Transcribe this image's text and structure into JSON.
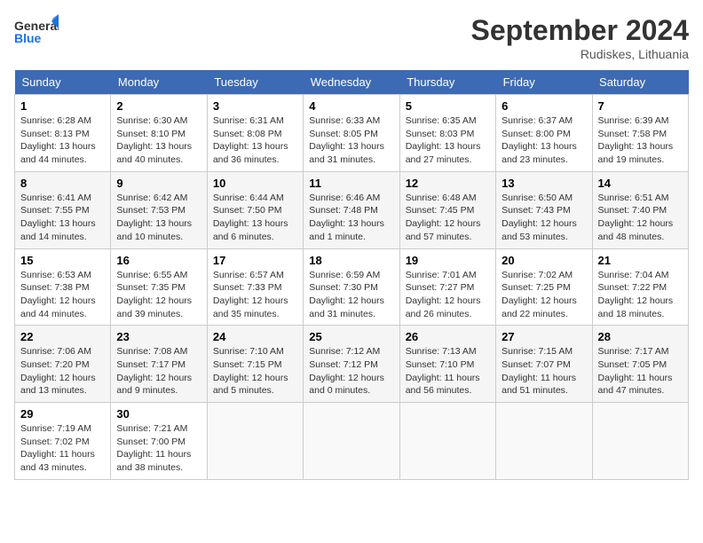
{
  "header": {
    "logo_general": "General",
    "logo_blue": "Blue",
    "month_title": "September 2024",
    "location": "Rudiskes, Lithuania"
  },
  "weekdays": [
    "Sunday",
    "Monday",
    "Tuesday",
    "Wednesday",
    "Thursday",
    "Friday",
    "Saturday"
  ],
  "weeks": [
    [
      {
        "day": "1",
        "info": "Sunrise: 6:28 AM\nSunset: 8:13 PM\nDaylight: 13 hours\nand 44 minutes."
      },
      {
        "day": "2",
        "info": "Sunrise: 6:30 AM\nSunset: 8:10 PM\nDaylight: 13 hours\nand 40 minutes."
      },
      {
        "day": "3",
        "info": "Sunrise: 6:31 AM\nSunset: 8:08 PM\nDaylight: 13 hours\nand 36 minutes."
      },
      {
        "day": "4",
        "info": "Sunrise: 6:33 AM\nSunset: 8:05 PM\nDaylight: 13 hours\nand 31 minutes."
      },
      {
        "day": "5",
        "info": "Sunrise: 6:35 AM\nSunset: 8:03 PM\nDaylight: 13 hours\nand 27 minutes."
      },
      {
        "day": "6",
        "info": "Sunrise: 6:37 AM\nSunset: 8:00 PM\nDaylight: 13 hours\nand 23 minutes."
      },
      {
        "day": "7",
        "info": "Sunrise: 6:39 AM\nSunset: 7:58 PM\nDaylight: 13 hours\nand 19 minutes."
      }
    ],
    [
      {
        "day": "8",
        "info": "Sunrise: 6:41 AM\nSunset: 7:55 PM\nDaylight: 13 hours\nand 14 minutes."
      },
      {
        "day": "9",
        "info": "Sunrise: 6:42 AM\nSunset: 7:53 PM\nDaylight: 13 hours\nand 10 minutes."
      },
      {
        "day": "10",
        "info": "Sunrise: 6:44 AM\nSunset: 7:50 PM\nDaylight: 13 hours\nand 6 minutes."
      },
      {
        "day": "11",
        "info": "Sunrise: 6:46 AM\nSunset: 7:48 PM\nDaylight: 13 hours\nand 1 minute."
      },
      {
        "day": "12",
        "info": "Sunrise: 6:48 AM\nSunset: 7:45 PM\nDaylight: 12 hours\nand 57 minutes."
      },
      {
        "day": "13",
        "info": "Sunrise: 6:50 AM\nSunset: 7:43 PM\nDaylight: 12 hours\nand 53 minutes."
      },
      {
        "day": "14",
        "info": "Sunrise: 6:51 AM\nSunset: 7:40 PM\nDaylight: 12 hours\nand 48 minutes."
      }
    ],
    [
      {
        "day": "15",
        "info": "Sunrise: 6:53 AM\nSunset: 7:38 PM\nDaylight: 12 hours\nand 44 minutes."
      },
      {
        "day": "16",
        "info": "Sunrise: 6:55 AM\nSunset: 7:35 PM\nDaylight: 12 hours\nand 39 minutes."
      },
      {
        "day": "17",
        "info": "Sunrise: 6:57 AM\nSunset: 7:33 PM\nDaylight: 12 hours\nand 35 minutes."
      },
      {
        "day": "18",
        "info": "Sunrise: 6:59 AM\nSunset: 7:30 PM\nDaylight: 12 hours\nand 31 minutes."
      },
      {
        "day": "19",
        "info": "Sunrise: 7:01 AM\nSunset: 7:27 PM\nDaylight: 12 hours\nand 26 minutes."
      },
      {
        "day": "20",
        "info": "Sunrise: 7:02 AM\nSunset: 7:25 PM\nDaylight: 12 hours\nand 22 minutes."
      },
      {
        "day": "21",
        "info": "Sunrise: 7:04 AM\nSunset: 7:22 PM\nDaylight: 12 hours\nand 18 minutes."
      }
    ],
    [
      {
        "day": "22",
        "info": "Sunrise: 7:06 AM\nSunset: 7:20 PM\nDaylight: 12 hours\nand 13 minutes."
      },
      {
        "day": "23",
        "info": "Sunrise: 7:08 AM\nSunset: 7:17 PM\nDaylight: 12 hours\nand 9 minutes."
      },
      {
        "day": "24",
        "info": "Sunrise: 7:10 AM\nSunset: 7:15 PM\nDaylight: 12 hours\nand 5 minutes."
      },
      {
        "day": "25",
        "info": "Sunrise: 7:12 AM\nSunset: 7:12 PM\nDaylight: 12 hours\nand 0 minutes."
      },
      {
        "day": "26",
        "info": "Sunrise: 7:13 AM\nSunset: 7:10 PM\nDaylight: 11 hours\nand 56 minutes."
      },
      {
        "day": "27",
        "info": "Sunrise: 7:15 AM\nSunset: 7:07 PM\nDaylight: 11 hours\nand 51 minutes."
      },
      {
        "day": "28",
        "info": "Sunrise: 7:17 AM\nSunset: 7:05 PM\nDaylight: 11 hours\nand 47 minutes."
      }
    ],
    [
      {
        "day": "29",
        "info": "Sunrise: 7:19 AM\nSunset: 7:02 PM\nDaylight: 11 hours\nand 43 minutes."
      },
      {
        "day": "30",
        "info": "Sunrise: 7:21 AM\nSunset: 7:00 PM\nDaylight: 11 hours\nand 38 minutes."
      },
      {
        "day": "",
        "info": ""
      },
      {
        "day": "",
        "info": ""
      },
      {
        "day": "",
        "info": ""
      },
      {
        "day": "",
        "info": ""
      },
      {
        "day": "",
        "info": ""
      }
    ]
  ]
}
